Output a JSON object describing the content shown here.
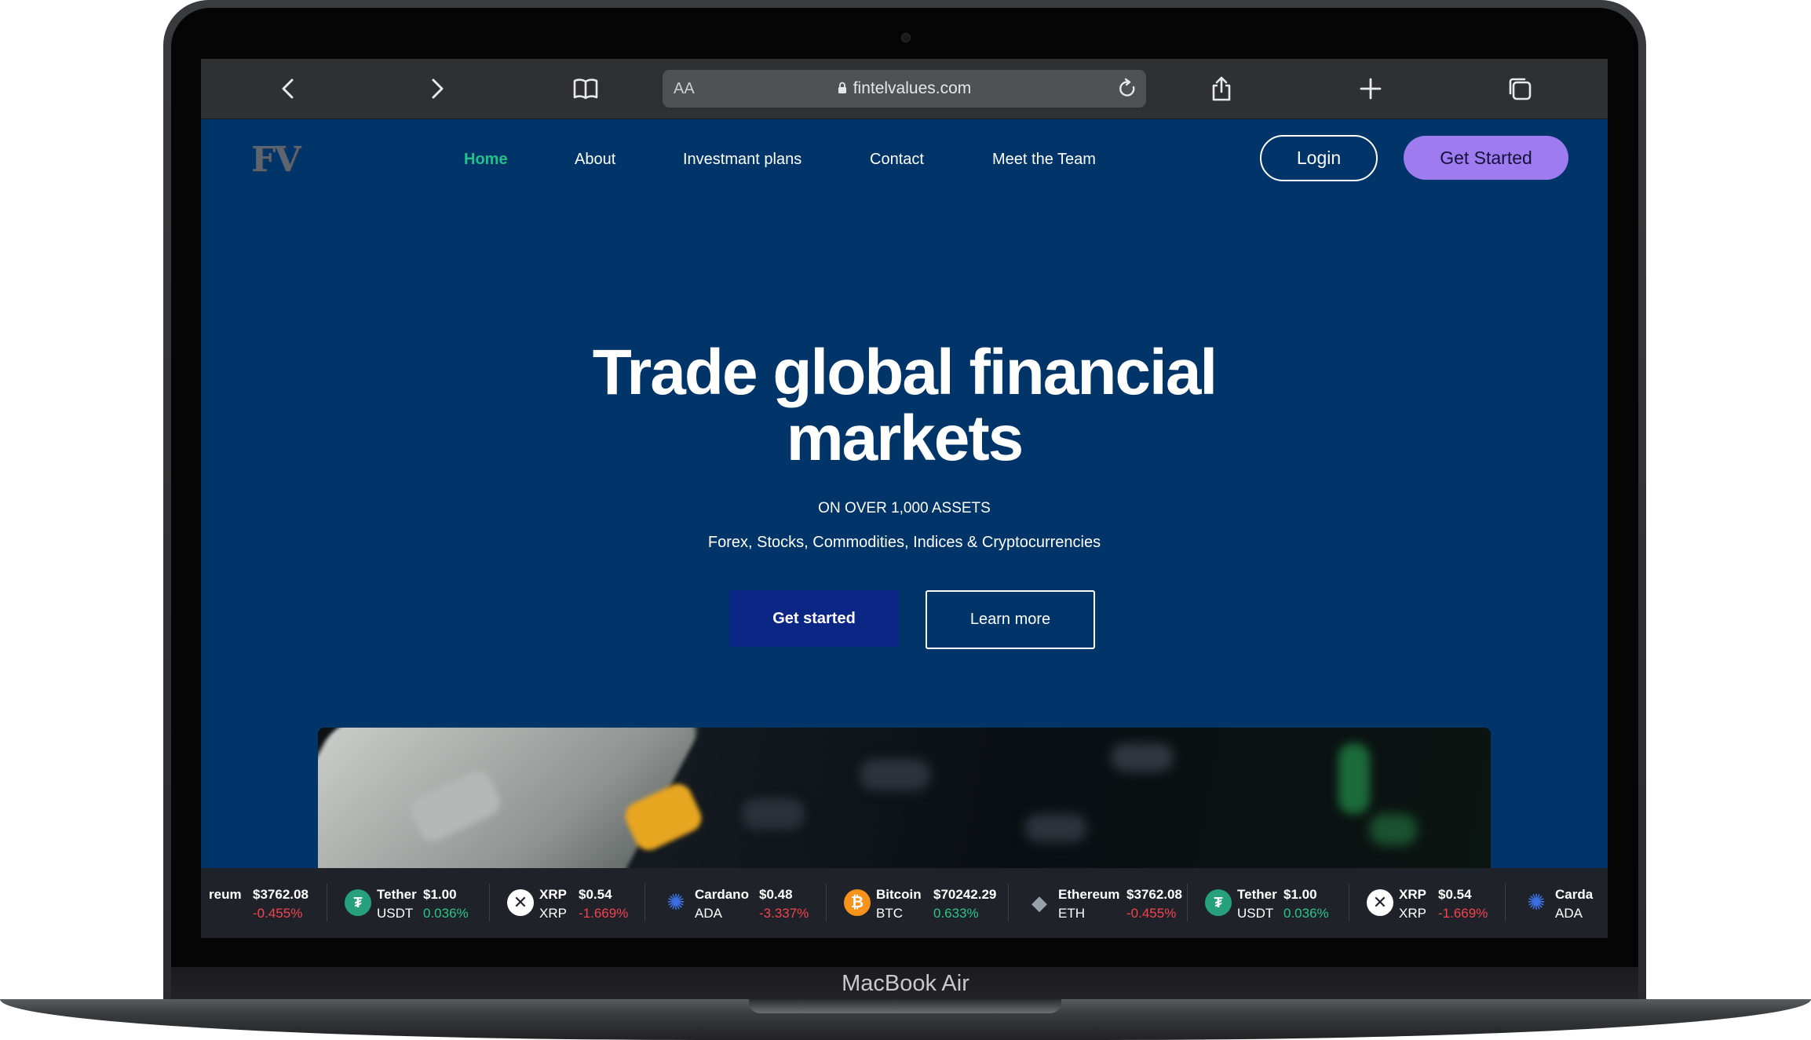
{
  "device": {
    "label": "MacBook Air"
  },
  "browser": {
    "text_size_label": "AA",
    "url": "fintelvalues.com"
  },
  "site": {
    "logo": "FV",
    "nav": [
      {
        "label": "Home",
        "active": true
      },
      {
        "label": "About"
      },
      {
        "label": "Investmant plans"
      },
      {
        "label": "Contact"
      },
      {
        "label": "Meet the Team"
      }
    ],
    "login_label": "Login",
    "get_started_label": "Get Started"
  },
  "hero": {
    "title_line1": "Trade global financial",
    "title_line2": "markets",
    "subtitle": "ON OVER 1,000 ASSETS",
    "description": "Forex, Stocks, Commodities, Indices & Cryptocurrencies",
    "primary_cta": "Get started",
    "secondary_cta": "Learn more"
  },
  "ticker": [
    {
      "name": "reum",
      "symbol": "",
      "price": "$3762.08",
      "change": "-0.455%",
      "direction": "down",
      "icon": "ethereum-icon"
    },
    {
      "name": "Tether",
      "symbol": "USDT",
      "price": "$1.00",
      "change": "0.036%",
      "direction": "up",
      "icon": "tether-icon"
    },
    {
      "name": "XRP",
      "symbol": "XRP",
      "price": "$0.54",
      "change": "-1.669%",
      "direction": "down",
      "icon": "xrp-icon"
    },
    {
      "name": "Cardano",
      "symbol": "ADA",
      "price": "$0.48",
      "change": "-3.337%",
      "direction": "down",
      "icon": "cardano-icon"
    },
    {
      "name": "Bitcoin",
      "symbol": "BTC",
      "price": "$70242.29",
      "change": "0.633%",
      "direction": "up",
      "icon": "bitcoin-icon"
    },
    {
      "name": "Ethereum",
      "symbol": "ETH",
      "price": "$3762.08",
      "change": "-0.455%",
      "direction": "down",
      "icon": "ethereum-icon"
    },
    {
      "name": "Tether",
      "symbol": "USDT",
      "price": "$1.00",
      "change": "0.036%",
      "direction": "up",
      "icon": "tether-icon"
    },
    {
      "name": "XRP",
      "symbol": "XRP",
      "price": "$0.54",
      "change": "-1.669%",
      "direction": "down",
      "icon": "xrp-icon"
    },
    {
      "name": "Carda",
      "symbol": "ADA",
      "price": "",
      "change": "",
      "direction": "down",
      "icon": "cardano-icon"
    }
  ],
  "colors": {
    "page_bg": "#013569",
    "accent_green": "#22c08a",
    "accent_purple": "#9e7cf0",
    "down_red": "#f2434f",
    "up_green": "#2bc488"
  }
}
